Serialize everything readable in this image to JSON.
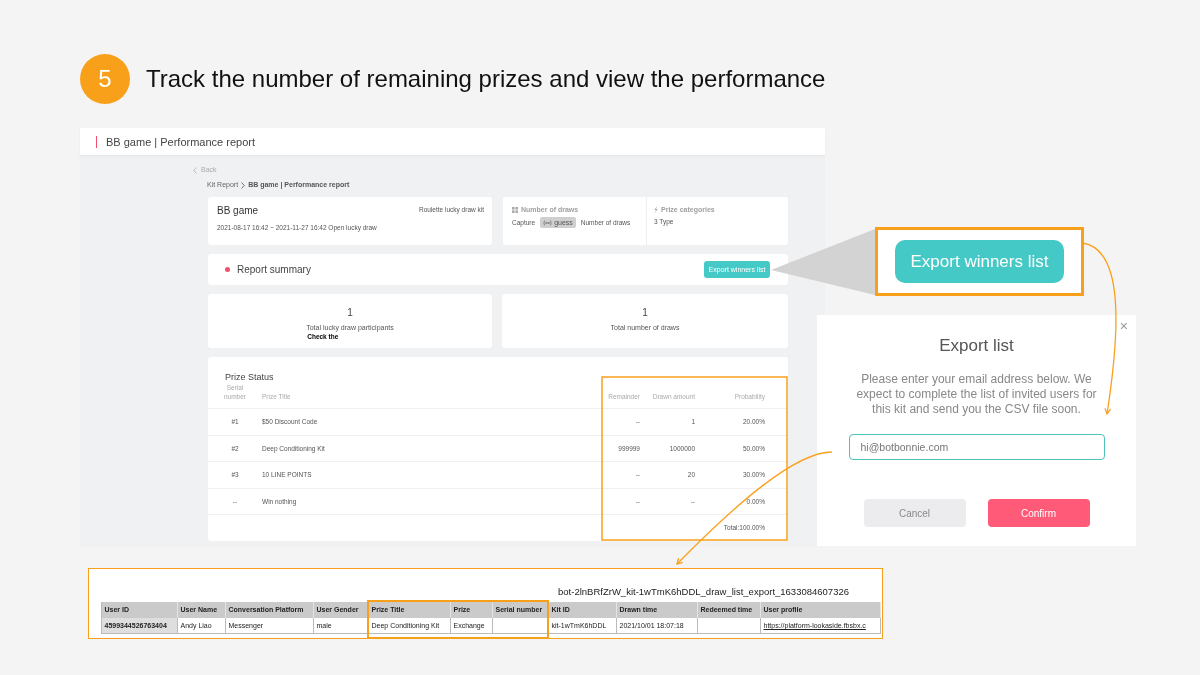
{
  "step": {
    "number": "5",
    "title": "Track the number of remaining prizes and view the performance"
  },
  "app": {
    "header_title": "BB game | Performance report",
    "back": "Back",
    "breadcrumb": [
      {
        "label": "Kit Report",
        "current": false
      },
      {
        "label": "BB game | Performance report",
        "current": true
      }
    ],
    "kit": {
      "name": "BB game",
      "type": "Roulette lucky draw kit",
      "period": "2021-08-17 16:42 ~ 2021-11-27 16:42 Open lucky draw"
    },
    "info": [
      {
        "kind": "draws",
        "label": "Number of draws",
        "parts": [
          {
            "kind": "text",
            "text": "Capture"
          },
          {
            "kind": "tag",
            "text": "guess"
          },
          {
            "kind": "text",
            "text": "Number of draws"
          }
        ]
      },
      {
        "kind": "categories",
        "label": "Prize categories",
        "parts": [
          {
            "kind": "text",
            "text": "3 Type"
          }
        ]
      }
    ],
    "summary": {
      "title": "Report summary",
      "button": "Export winners list"
    },
    "stats": [
      {
        "value": "1",
        "label": "Total lucky draw participants",
        "note": "Check the"
      },
      {
        "value": "1",
        "label": "Total number of draws"
      }
    ],
    "prize_status": {
      "title": "Prize Status",
      "columns": [
        "Serial number",
        "Prize Title",
        "Remainder",
        "Drawn amount",
        "Probability"
      ],
      "rows": [
        [
          "#1",
          "$50 Discount Code",
          "--",
          "1",
          "20.00%"
        ],
        [
          "#2",
          "Deep Conditioning Kit",
          "999999",
          "1000000",
          "50.00%"
        ],
        [
          "#3",
          "10 LINE POINTS",
          "--",
          "20",
          "30.00%"
        ],
        [
          "--",
          "Win nothing",
          "--",
          "--",
          "0.00%"
        ]
      ],
      "total": "Total:100.00%"
    }
  },
  "callout": {
    "button": "Export winners list"
  },
  "dialog": {
    "close": "×",
    "title": "Export list",
    "message": "Please enter your email address below. We expect to complete the list of invited users for this kit and send you the CSV file soon.",
    "email": "hi@botbonnie.com",
    "buttons": [
      {
        "kind": "cancel",
        "label": "Cancel"
      },
      {
        "kind": "confirm",
        "label": "Confirm"
      }
    ]
  },
  "export_sheet": {
    "filename": "bot-2lnBRfZrW_kit-1wTmK6hDDL_draw_list_export_1633084607326",
    "columns": [
      {
        "label": "User ID",
        "kind": "id"
      },
      {
        "label": "User Name",
        "kind": "text"
      },
      {
        "label": "Conversation Platform",
        "kind": "text"
      },
      {
        "label": "User Gender",
        "kind": "text"
      },
      {
        "label": "Prize Title",
        "kind": "text"
      },
      {
        "label": "Prize",
        "kind": "text"
      },
      {
        "label": "Serial number",
        "kind": "text"
      },
      {
        "label": "Kit ID",
        "kind": "text"
      },
      {
        "label": "Drawn time",
        "kind": "text"
      },
      {
        "label": "Redeemed time",
        "kind": "text"
      },
      {
        "label": "User profile",
        "kind": "link"
      }
    ],
    "rows": [
      [
        "4599344526763404",
        "Andy Liao",
        "Messenger",
        "male",
        "Deep Conditioning Kit",
        "Exchange",
        null,
        "kit-1wTmK6hDDL",
        "2021/10/01 18:07:18",
        null,
        "https://platform-lookaside.fbsbx.c"
      ]
    ]
  }
}
